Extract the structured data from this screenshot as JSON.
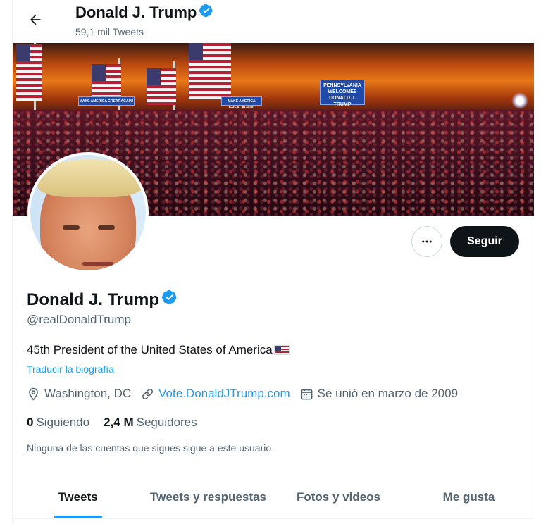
{
  "header": {
    "name": "Donald J. Trump",
    "tweet_count": "59,1 mil Tweets"
  },
  "profile": {
    "name": "Donald J. Trump",
    "handle": "@realDonaldTrump",
    "bio": "45th President of the United States of America",
    "translate": "Traducir la biografía",
    "location": "Washington, DC",
    "website": "Vote.DonaldJTrump.com",
    "joined": "Se unió en marzo de 2009",
    "following_count": "0",
    "following_label": "Siguiendo",
    "followers_count": "2,4 M",
    "followers_label": "Seguidores",
    "notice": "Ninguna de las cuentas que sigues sigue a este usuario",
    "verified_color": "#1d9bf0"
  },
  "actions": {
    "more_icon": "more-horizontal-icon",
    "follow_label": "Seguir"
  },
  "banner": {
    "sign_text_1": "PENNSYLVANIA WELCOMES DONALD J. TRUMP",
    "sign_text_2": "MAKE AMERICA GREAT AGAIN!",
    "sign_text_3": "MAKE AMERICA GREAT AGAIN!"
  },
  "tabs": [
    {
      "label": "Tweets",
      "active": true
    },
    {
      "label": "Tweets y respuestas",
      "active": false
    },
    {
      "label": "Fotos y videos",
      "active": false
    },
    {
      "label": "Me gusta",
      "active": false
    }
  ],
  "colors": {
    "accent": "#1d9bf0",
    "text": "#0f1419",
    "secondary": "#536471"
  }
}
